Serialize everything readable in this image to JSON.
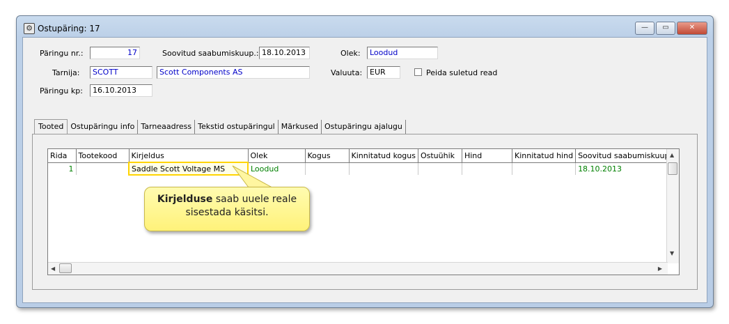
{
  "window": {
    "title": "Ostupäring: 17",
    "buttons": {
      "minimize": "—",
      "maximize": "▭",
      "close": "✕"
    }
  },
  "header": {
    "request_no_label": "Päringu nr.:",
    "request_no_value": "17",
    "desired_arrival_label": "Soovitud saabumiskuup.:",
    "desired_arrival_value": "18.10.2013",
    "status_label": "Olek:",
    "status_value": "Loodud",
    "supplier_label": "Tarnija:",
    "supplier_code": "SCOTT",
    "supplier_name": "Scott Components AS",
    "currency_label": "Valuuta:",
    "currency_value": "EUR",
    "hide_closed_label": "Peida suletud read",
    "request_date_label": "Päringu kp:",
    "request_date_value": "16.10.2013"
  },
  "tabs": [
    "Tooted",
    "Ostupäringu info",
    "Tarneaadress",
    "Tekstid ostupäringul",
    "Märkused",
    "Ostupäringu ajalugu"
  ],
  "grid": {
    "columns": [
      "Rida",
      "Tootekood",
      "Kirjeldus",
      "Olek",
      "Kogus",
      "Kinnitatud kogus",
      "Ostuühik",
      "Hind",
      "Kinnitatud hind",
      "Soovitud saabumiskuup."
    ],
    "rows": [
      {
        "rida": "1",
        "tootekood": "",
        "kirjeldus": "Saddle Scott Voltage MS",
        "olek": "Loodud",
        "kogus": "",
        "kinnitatud_kogus": "",
        "ostuyhik": "",
        "hind": "",
        "kinnitatud_hind": "",
        "soovitud": "18.10.2013"
      }
    ]
  },
  "callout": {
    "bold": "Kirjelduse",
    "text_line1": " saab uuele reale",
    "text_line2": "sisestada käsitsi."
  },
  "colors": {
    "highlight": "#ffd400",
    "callout_bg": "#fff27a",
    "status_green": "#008000",
    "link_blue": "#0000c8"
  },
  "icons": {
    "app": "app-icon",
    "scroll_up": "▲",
    "scroll_down": "▼",
    "scroll_left": "◀",
    "scroll_right": "▶"
  }
}
